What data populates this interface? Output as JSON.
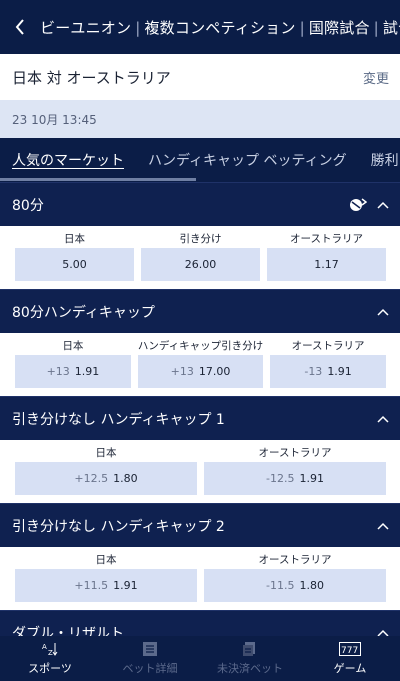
{
  "header": {
    "back_icon": "chevron-left-icon",
    "breadcrumbs": [
      "ビーユニオン",
      "複数コンペティション",
      "国際試合",
      "試合"
    ]
  },
  "match": {
    "title": "日本 対 オーストラリア",
    "change_label": "変更",
    "datetime": "23 10月 13:45"
  },
  "tabs": [
    {
      "label": "人気のマーケット",
      "active": true
    },
    {
      "label": "ハンディキャップ ベッティング",
      "active": false
    },
    {
      "label": "勝利マージン",
      "active": false
    }
  ],
  "sections": [
    {
      "title": "80分",
      "has_swap_icon": true,
      "columns": [
        {
          "label": "日本",
          "handicap": "",
          "odds": "5.00"
        },
        {
          "label": "引き分け",
          "handicap": "",
          "odds": "26.00"
        },
        {
          "label": "オーストラリア",
          "handicap": "",
          "odds": "1.17"
        }
      ]
    },
    {
      "title": "80分ハンディキャップ",
      "columns": [
        {
          "label": "日本",
          "handicap": "+13",
          "odds": "1.91"
        },
        {
          "label": "ハンディキャップ引き分け",
          "handicap": "+13",
          "odds": "17.00"
        },
        {
          "label": "オーストラリア",
          "handicap": "-13",
          "odds": "1.91"
        }
      ]
    },
    {
      "title": "引き分けなし ハンディキャップ 1",
      "columns": [
        {
          "label": "日本",
          "handicap": "+12.5",
          "odds": "1.80"
        },
        {
          "label": "オーストラリア",
          "handicap": "-12.5",
          "odds": "1.91"
        }
      ]
    },
    {
      "title": "引き分けなし ハンディキャップ 2",
      "columns": [
        {
          "label": "日本",
          "handicap": "+11.5",
          "odds": "1.91"
        },
        {
          "label": "オーストラリア",
          "handicap": "-11.5",
          "odds": "1.80"
        }
      ]
    },
    {
      "title": "ダブル・リザルト",
      "columns": []
    }
  ],
  "bottom_nav": [
    {
      "label": "スポーツ",
      "icon": "az-sort-icon",
      "active": true
    },
    {
      "label": "ベット詳細",
      "icon": "bet-slip-icon",
      "active": false
    },
    {
      "label": "未決済ベット",
      "icon": "open-bets-icon",
      "active": false
    },
    {
      "label": "ゲーム",
      "icon": "slot-777-icon",
      "active": true
    }
  ],
  "colors": {
    "navy": "#0b1d47",
    "section_header": "#0f2150",
    "odds_button": "#d7e0f4",
    "date_bar": "#dde5f4"
  }
}
